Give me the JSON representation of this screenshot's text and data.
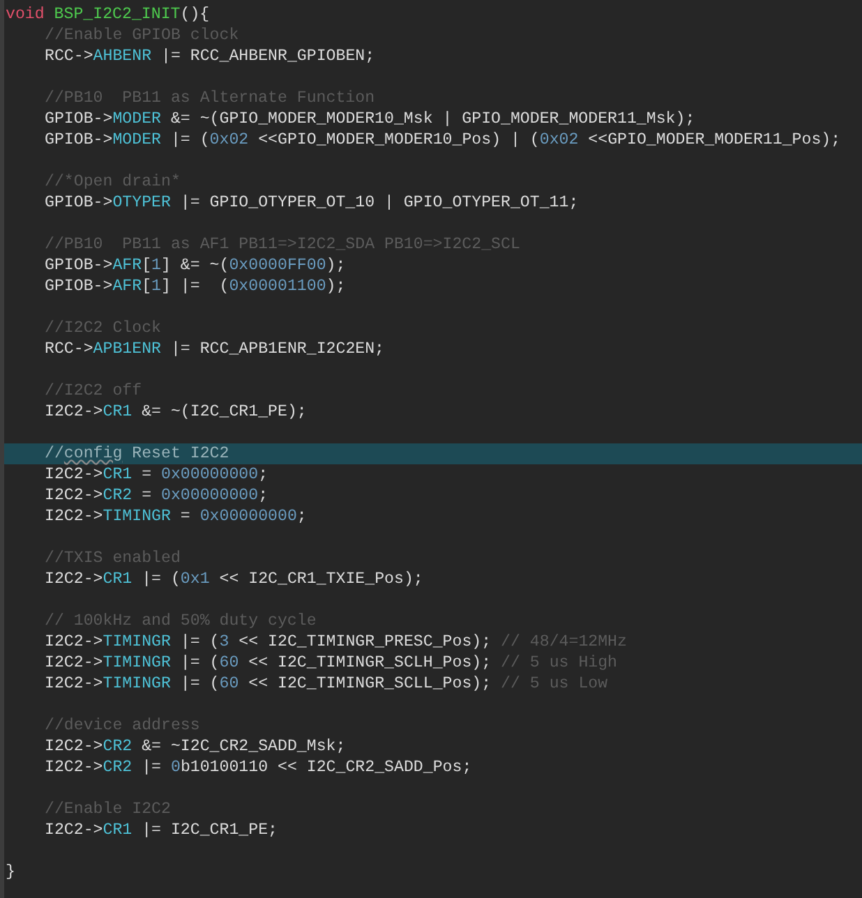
{
  "editor": {
    "lines": [
      {
        "indented": false,
        "highlighted": false,
        "tokens": [
          {
            "kind": "keyword",
            "text": "void"
          },
          {
            "kind": "function",
            "text": "BSP_I2C2_INIT"
          },
          {
            "kind": "text",
            "text": "(){"
          }
        ]
      },
      {
        "indented": true,
        "highlighted": false,
        "tokens": [
          {
            "kind": "comment",
            "text": "//Enable GPIOB clock"
          }
        ]
      },
      {
        "indented": true,
        "highlighted": false,
        "tokens": [
          {
            "kind": "text",
            "text": "RCC->"
          },
          {
            "kind": "member",
            "text": "AHBENR"
          },
          {
            "kind": "text",
            "text": " |= RCC_AHBENR_GPIOBEN;"
          }
        ]
      },
      {
        "indented": false,
        "highlighted": false
      },
      {
        "indented": true,
        "highlighted": false,
        "tokens": [
          {
            "kind": "comment",
            "text": "//PB10  PB11 as Alternate Function"
          }
        ]
      },
      {
        "indented": true,
        "highlighted": false,
        "tokens": [
          {
            "kind": "text",
            "text": "GPIOB->"
          },
          {
            "kind": "member",
            "text": "MODER"
          },
          {
            "kind": "text",
            "text": " &= ~(GPIO_MODER_MODER10_Msk | GPIO_MODER_MODER11_Msk);"
          }
        ]
      },
      {
        "indented": true,
        "highlighted": false,
        "tokens": [
          {
            "kind": "text",
            "text": "GPIOB->"
          },
          {
            "kind": "member",
            "text": "MODER"
          },
          {
            "kind": "text",
            "text": " |= ("
          },
          {
            "kind": "number",
            "text": "0x02"
          },
          {
            "kind": "text",
            "text": " <<GPIO_MODER_MODER10_Pos) | ("
          },
          {
            "kind": "number",
            "text": "0x02"
          },
          {
            "kind": "text",
            "text": " <<GPIO_MODER_MODER11_Pos);"
          }
        ]
      },
      {
        "indented": false,
        "highlighted": false
      },
      {
        "indented": true,
        "highlighted": false,
        "tokens": [
          {
            "kind": "comment",
            "text": "//*Open drain*"
          }
        ]
      },
      {
        "indented": true,
        "highlighted": false,
        "tokens": [
          {
            "kind": "text",
            "text": "GPIOB->"
          },
          {
            "kind": "member",
            "text": "OTYPER"
          },
          {
            "kind": "text",
            "text": " |= GPIO_OTYPER_OT_10 | GPIO_OTYPER_OT_11;"
          }
        ]
      },
      {
        "indented": false,
        "highlighted": false
      },
      {
        "indented": true,
        "highlighted": false,
        "tokens": [
          {
            "kind": "comment",
            "text": "//PB10  PB11 as AF1 PB11=>I2C2_SDA PB10=>I2C2_SCL"
          }
        ]
      },
      {
        "indented": true,
        "highlighted": false,
        "tokens": [
          {
            "kind": "text",
            "text": "GPIOB->"
          },
          {
            "kind": "member",
            "text": "AFR"
          },
          {
            "kind": "text",
            "text": "["
          },
          {
            "kind": "number",
            "text": "1"
          },
          {
            "kind": "text",
            "text": "] &= ~("
          },
          {
            "kind": "number",
            "text": "0x0000FF00"
          },
          {
            "kind": "text",
            "text": ");"
          }
        ]
      },
      {
        "indented": true,
        "highlighted": false,
        "tokens": [
          {
            "kind": "text",
            "text": "GPIOB->"
          },
          {
            "kind": "member",
            "text": "AFR"
          },
          {
            "kind": "text",
            "text": "["
          },
          {
            "kind": "number",
            "text": "1"
          },
          {
            "kind": "text",
            "text": "] |=  ("
          },
          {
            "kind": "number",
            "text": "0x00001100"
          },
          {
            "kind": "text",
            "text": ");"
          }
        ]
      },
      {
        "indented": false,
        "highlighted": false
      },
      {
        "indented": true,
        "highlighted": false,
        "tokens": [
          {
            "kind": "comment",
            "text": "//I2C2 Clock"
          }
        ]
      },
      {
        "indented": true,
        "highlighted": false,
        "tokens": [
          {
            "kind": "text",
            "text": "RCC->"
          },
          {
            "kind": "member",
            "text": "APB1ENR"
          },
          {
            "kind": "text",
            "text": " |= RCC_APB1ENR_I2C2EN;"
          }
        ]
      },
      {
        "indented": false,
        "highlighted": false
      },
      {
        "indented": true,
        "highlighted": false,
        "tokens": [
          {
            "kind": "comment",
            "text": "//I2C2 off"
          }
        ]
      },
      {
        "indented": true,
        "highlighted": false,
        "tokens": [
          {
            "kind": "text",
            "text": "I2C2->"
          },
          {
            "kind": "member",
            "text": "CR1"
          },
          {
            "kind": "text",
            "text": " &= ~(I2C_CR1_PE);"
          }
        ]
      },
      {
        "indented": false,
        "highlighted": false
      },
      {
        "indented": true,
        "highlighted": true,
        "tokens": [
          {
            "kind": "comment",
            "text": "//"
          },
          {
            "kind": "misspelled",
            "text": "config"
          },
          {
            "kind": "comment",
            "text": " Reset I2C2"
          }
        ]
      },
      {
        "indented": true,
        "highlighted": false,
        "tokens": [
          {
            "kind": "text",
            "text": "I2C2->"
          },
          {
            "kind": "member",
            "text": "CR1"
          },
          {
            "kind": "text",
            "text": " = "
          },
          {
            "kind": "number",
            "text": "0x00000000"
          },
          {
            "kind": "text",
            "text": ";"
          }
        ]
      },
      {
        "indented": true,
        "highlighted": false,
        "tokens": [
          {
            "kind": "text",
            "text": "I2C2->"
          },
          {
            "kind": "member",
            "text": "CR2"
          },
          {
            "kind": "text",
            "text": " = "
          },
          {
            "kind": "number",
            "text": "0x00000000"
          },
          {
            "kind": "text",
            "text": ";"
          }
        ]
      },
      {
        "indented": true,
        "highlighted": false,
        "tokens": [
          {
            "kind": "text",
            "text": "I2C2->"
          },
          {
            "kind": "member",
            "text": "TIMINGR"
          },
          {
            "kind": "text",
            "text": " = "
          },
          {
            "kind": "number",
            "text": "0x00000000"
          },
          {
            "kind": "text",
            "text": ";"
          }
        ]
      },
      {
        "indented": false,
        "highlighted": false
      },
      {
        "indented": true,
        "highlighted": false,
        "tokens": [
          {
            "kind": "comment",
            "text": "//TXIS enabled"
          }
        ]
      },
      {
        "indented": true,
        "highlighted": false,
        "tokens": [
          {
            "kind": "text",
            "text": "I2C2->"
          },
          {
            "kind": "member",
            "text": "CR1"
          },
          {
            "kind": "text",
            "text": " |= ("
          },
          {
            "kind": "number",
            "text": "0x1"
          },
          {
            "kind": "text",
            "text": " << I2C_CR1_TXIE_Pos);"
          }
        ]
      },
      {
        "indented": false,
        "highlighted": false
      },
      {
        "indented": true,
        "highlighted": false,
        "tokens": [
          {
            "kind": "comment",
            "text": "// 100kHz and 50% duty cycle"
          }
        ]
      },
      {
        "indented": true,
        "highlighted": false,
        "tokens": [
          {
            "kind": "text",
            "text": "I2C2->"
          },
          {
            "kind": "member",
            "text": "TIMINGR"
          },
          {
            "kind": "text",
            "text": " |= ("
          },
          {
            "kind": "number",
            "text": "3"
          },
          {
            "kind": "text",
            "text": " << I2C_TIMINGR_PRESC_Pos); "
          },
          {
            "kind": "comment",
            "text": "// 48/4=12MHz"
          }
        ]
      },
      {
        "indented": true,
        "highlighted": false,
        "tokens": [
          {
            "kind": "text",
            "text": "I2C2->"
          },
          {
            "kind": "member",
            "text": "TIMINGR"
          },
          {
            "kind": "text",
            "text": " |= ("
          },
          {
            "kind": "number",
            "text": "60"
          },
          {
            "kind": "text",
            "text": " << I2C_TIMINGR_SCLH_Pos); "
          },
          {
            "kind": "comment",
            "text": "// 5 us High"
          }
        ]
      },
      {
        "indented": true,
        "highlighted": false,
        "tokens": [
          {
            "kind": "text",
            "text": "I2C2->"
          },
          {
            "kind": "member",
            "text": "TIMINGR"
          },
          {
            "kind": "text",
            "text": " |= ("
          },
          {
            "kind": "number",
            "text": "60"
          },
          {
            "kind": "text",
            "text": " << I2C_TIMINGR_SCLL_Pos); "
          },
          {
            "kind": "comment",
            "text": "// 5 us Low"
          }
        ]
      },
      {
        "indented": false,
        "highlighted": false
      },
      {
        "indented": true,
        "highlighted": false,
        "tokens": [
          {
            "kind": "comment",
            "text": "//device address"
          }
        ]
      },
      {
        "indented": true,
        "highlighted": false,
        "tokens": [
          {
            "kind": "text",
            "text": "I2C2->"
          },
          {
            "kind": "member",
            "text": "CR2"
          },
          {
            "kind": "text",
            "text": " &= ~I2C_CR2_SADD_Msk;"
          }
        ]
      },
      {
        "indented": true,
        "highlighted": false,
        "tokens": [
          {
            "kind": "text",
            "text": "I2C2->"
          },
          {
            "kind": "member",
            "text": "CR2"
          },
          {
            "kind": "text",
            "text": " |= "
          },
          {
            "kind": "number",
            "text": "0"
          },
          {
            "kind": "text",
            "text": "b10100110 << I2C_CR2_SADD_Pos;"
          }
        ]
      },
      {
        "indented": false,
        "highlighted": false
      },
      {
        "indented": true,
        "highlighted": false,
        "tokens": [
          {
            "kind": "comment",
            "text": "//Enable I2C2"
          }
        ]
      },
      {
        "indented": true,
        "highlighted": false,
        "tokens": [
          {
            "kind": "text",
            "text": "I2C2->"
          },
          {
            "kind": "member",
            "text": "CR1"
          },
          {
            "kind": "text",
            "text": " |= I2C_CR1_PE;"
          }
        ]
      },
      {
        "indented": false,
        "highlighted": false
      },
      {
        "indented": false,
        "highlighted": false,
        "tokens": [
          {
            "kind": "text",
            "text": "}"
          }
        ]
      }
    ]
  }
}
